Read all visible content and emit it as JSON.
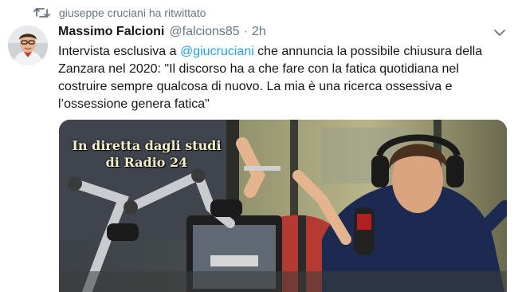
{
  "retweet": {
    "label": "giuseppe cruciani ha ritwittato",
    "icon": "retweet-icon"
  },
  "author": {
    "name": "Massimo Falcioni",
    "handle": "@falcions85",
    "separator": "·",
    "time": "2h"
  },
  "tweet": {
    "text_before": "Intervista esclusiva a ",
    "mention": "@giucruciani",
    "text_after": " che annuncia la possibile chiusura della\nZanzara nel 2020:  \"Il discorso ha a che fare con la fatica quotidiana nel\ncostruire sempre qualcosa di nuovo. La mia è una ricerca ossessiva e\nl’ossessione genera fatica\""
  },
  "media": {
    "studio_sign": "In diretta dagli studi\ndi Radio 24"
  },
  "colors": {
    "accent": "#1da1f2",
    "secondary_text": "#657786",
    "primary_text": "#14171a"
  }
}
